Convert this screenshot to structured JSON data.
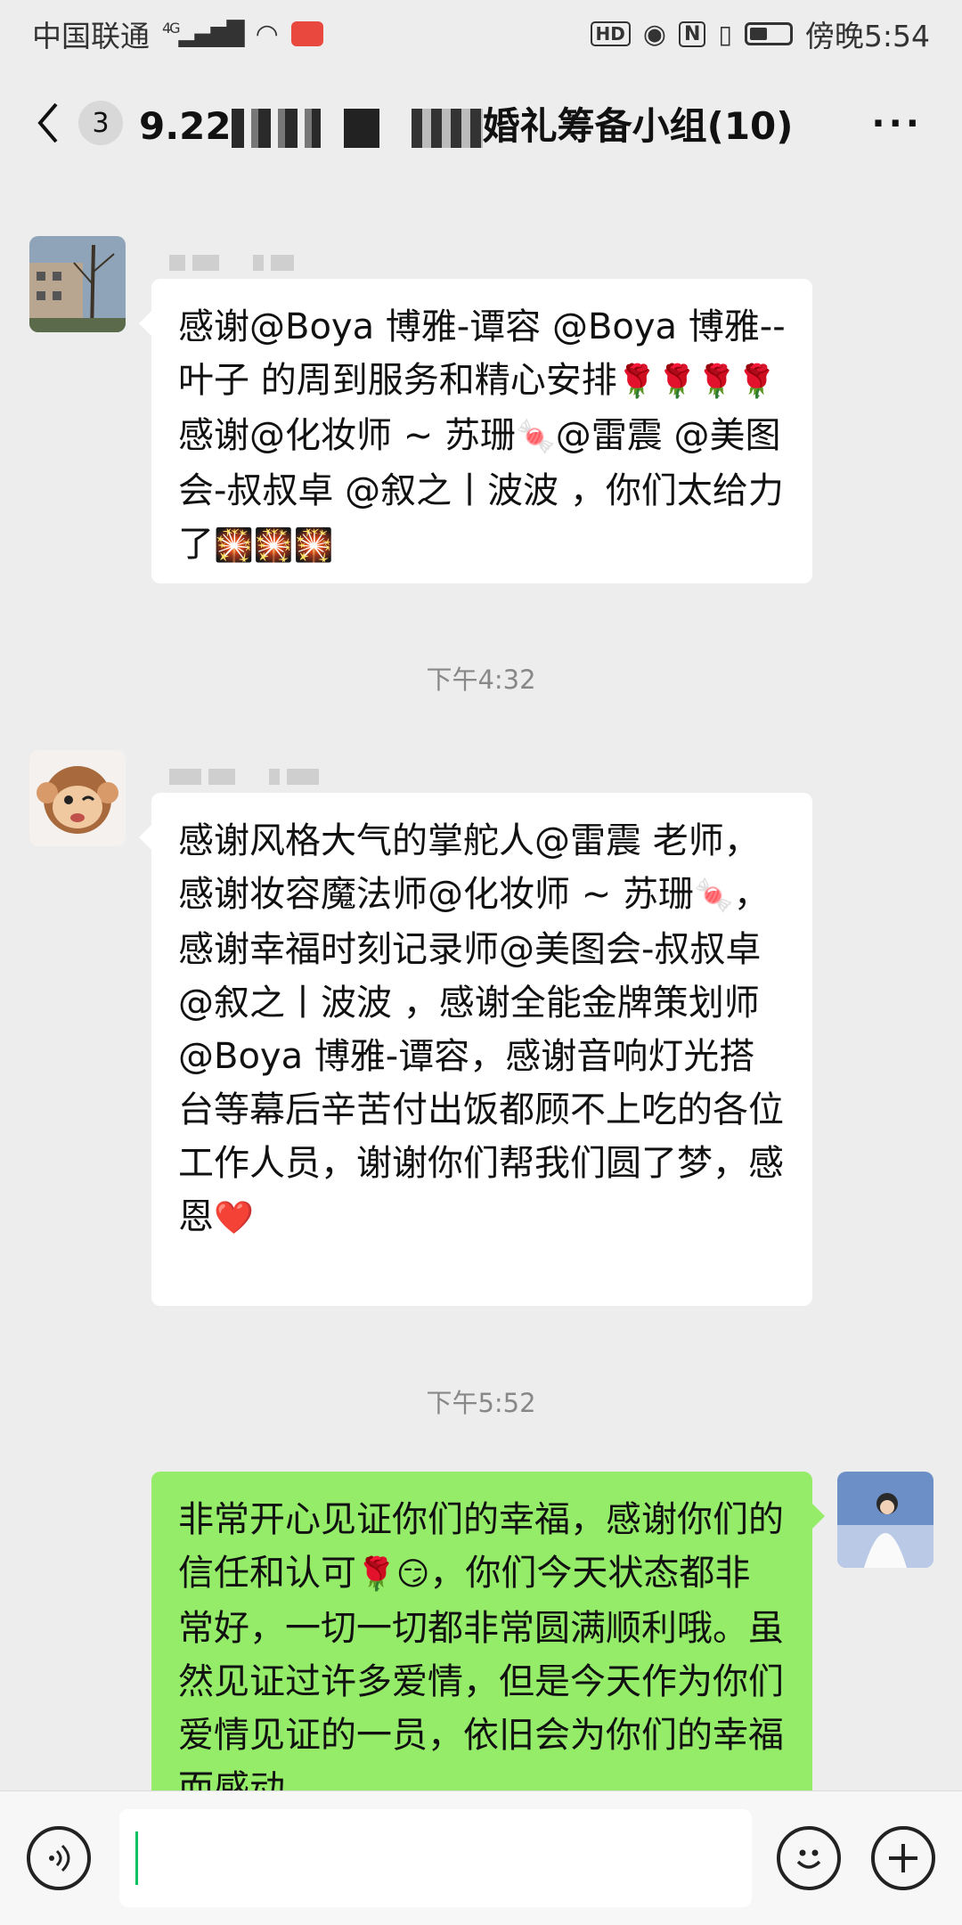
{
  "status_bar": {
    "carrier": "中国联通",
    "network": "4G",
    "time": "傍晚5:54",
    "hd_label": "HD",
    "nfc_label": "N",
    "battery_level": 0.45
  },
  "header": {
    "back_icon": "chevron-left-icon",
    "unread_count": "3",
    "title_start": "9.22",
    "title_end": "婚礼筹备小组(10)",
    "more_icon": "ellipsis-icon"
  },
  "messages": [
    {
      "side": "left",
      "avatar": "building-photo",
      "text_parts": [
        "感谢@Boya 博雅-谭容  @Boya 博雅--叶子  的周到服务和精心安排",
        "🌹🌹🌹🌹",
        "感谢@化妆师 ~ 苏珊",
        "🍬",
        "@雷震  @美图会-叔叔卓  @叙之丨波波 ，你们太给力了",
        "🎇🎇🎇"
      ]
    },
    {
      "side": "left",
      "avatar": "monkey-wink",
      "text_parts": [
        "感谢风格大气的掌舵人@雷震  老师，感谢妆容魔法师@化妆师 ~ 苏珊",
        "🍬",
        "，感谢幸福时刻记录师@美图会-叔叔卓  @叙之丨波波 ，感谢全能金牌策划师@Boya 博雅-谭容，感谢音响灯光搭台等幕后辛苦付出饭都顾不上吃的各位工作人员，谢谢你们帮我们圆了梦，感恩",
        "❤️"
      ]
    },
    {
      "side": "right",
      "avatar": "bride-photo",
      "text_parts": [
        "非常开心见证你们的幸福，感谢你们的信任和认可",
        "🌹😏",
        "，你们今天状态都非常好，一切一切都非常圆满顺利哦。虽然见证过许多爱情，但是今天作为你们爱情见证的一员，依旧会为你们的幸福而感动"
      ]
    }
  ],
  "timestamps": [
    "下午4:32",
    "下午5:52"
  ],
  "input_bar": {
    "voice_icon": "voice-icon",
    "emoji_icon": "emoji-icon",
    "plus_icon": "plus-icon"
  },
  "colors": {
    "background": "#ededed",
    "bubble_left": "#ffffff",
    "bubble_right": "#95ec69",
    "accent": "#07c160"
  }
}
